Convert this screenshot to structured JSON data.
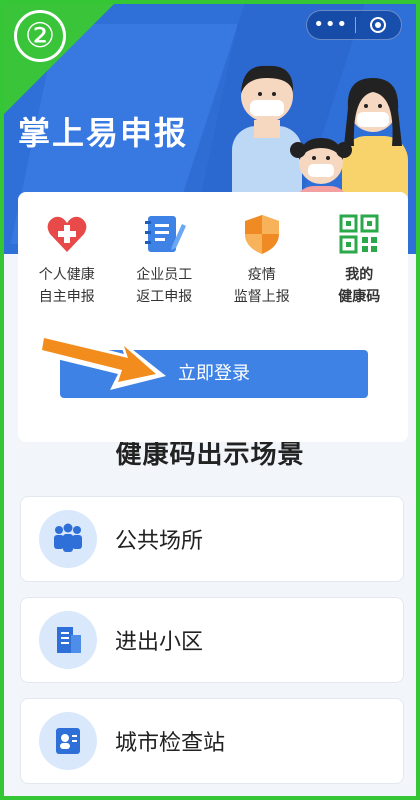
{
  "step": "②",
  "header": {
    "app_title": "掌上易申报",
    "capsule_more": "•••"
  },
  "menu": [
    {
      "line1": "个人健康",
      "line2": "自主申报",
      "icon": "heart-plus-icon",
      "color": "#e84a4a"
    },
    {
      "line1": "企业员工",
      "line2": "返工申报",
      "icon": "notebook-pen-icon",
      "color": "#3d82e4"
    },
    {
      "line1": "疫情",
      "line2": "监督上报",
      "icon": "shield-icon",
      "color": "#f08a24"
    },
    {
      "line1": "我的",
      "line2": "健康码",
      "icon": "qr-code-icon",
      "color": "#2aa84a"
    }
  ],
  "login_button": "立即登录",
  "section_title": "健康码出示场景",
  "scenes": [
    {
      "name": "公共场所",
      "icon": "people-group-icon"
    },
    {
      "name": "进出小区",
      "icon": "building-icon"
    },
    {
      "name": "城市检查站",
      "icon": "id-card-icon"
    }
  ],
  "colors": {
    "accent_blue": "#3d82e4",
    "banner_blue": "#2f6fd8",
    "arrow_orange": "#f28c1c",
    "frame_green": "#35c635"
  }
}
